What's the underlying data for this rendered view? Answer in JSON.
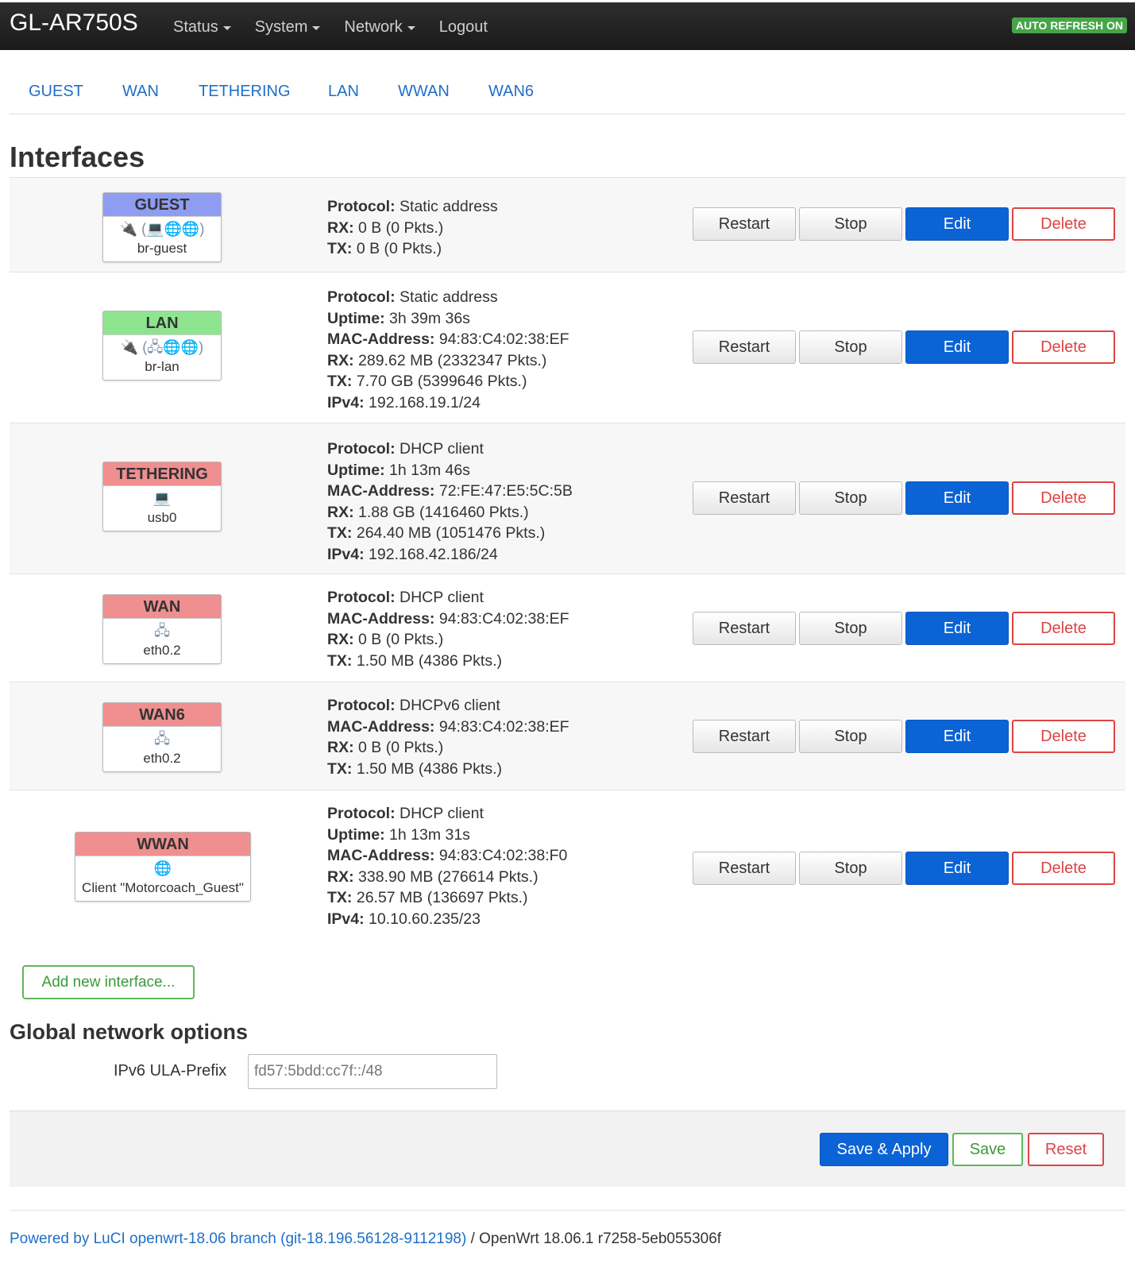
{
  "navbar": {
    "brand": "GL-AR750S",
    "menu": [
      {
        "label": "Status",
        "dropdown": true
      },
      {
        "label": "System",
        "dropdown": true
      },
      {
        "label": "Network",
        "dropdown": true
      },
      {
        "label": "Logout",
        "dropdown": false
      }
    ],
    "auto_refresh": "AUTO REFRESH ON"
  },
  "tabs": [
    "GUEST",
    "WAN",
    "TETHERING",
    "LAN",
    "WWAN",
    "WAN6"
  ],
  "page_title": "Interfaces",
  "buttons": {
    "restart": "Restart",
    "stop": "Stop",
    "edit": "Edit",
    "delete": "Delete"
  },
  "interfaces": [
    {
      "name": "GUEST",
      "header_color": "#8e9cf2",
      "icons": "🔌 (💻🌐🌐)",
      "device": "br-guest",
      "info": [
        {
          "label": "Protocol:",
          "value": "Static address"
        },
        {
          "label": "RX:",
          "value": "0 B (0 Pkts.)"
        },
        {
          "label": "TX:",
          "value": "0 B (0 Pkts.)"
        }
      ]
    },
    {
      "name": "LAN",
      "header_color": "#8fe58f",
      "icons": "🔌 (🖧🌐🌐)",
      "device": "br-lan",
      "info": [
        {
          "label": "Protocol:",
          "value": "Static address"
        },
        {
          "label": "Uptime:",
          "value": "3h 39m 36s"
        },
        {
          "label": "MAC-Address:",
          "value": "94:83:C4:02:38:EF"
        },
        {
          "label": "RX:",
          "value": "289.62 MB (2332347 Pkts.)"
        },
        {
          "label": "TX:",
          "value": "7.70 GB (5399646 Pkts.)"
        },
        {
          "label": "IPv4:",
          "value": "192.168.19.1/24"
        }
      ]
    },
    {
      "name": "TETHERING",
      "header_color": "#ef8f8f",
      "icons": "💻",
      "device": "usb0",
      "info": [
        {
          "label": "Protocol:",
          "value": "DHCP client"
        },
        {
          "label": "Uptime:",
          "value": "1h 13m 46s"
        },
        {
          "label": "MAC-Address:",
          "value": "72:FE:47:E5:5C:5B"
        },
        {
          "label": "RX:",
          "value": "1.88 GB (1416460 Pkts.)"
        },
        {
          "label": "TX:",
          "value": "264.40 MB (1051476 Pkts.)"
        },
        {
          "label": "IPv4:",
          "value": "192.168.42.186/24"
        }
      ]
    },
    {
      "name": "WAN",
      "header_color": "#ef8f8f",
      "icons": "🖧",
      "device": "eth0.2",
      "info": [
        {
          "label": "Protocol:",
          "value": "DHCP client"
        },
        {
          "label": "MAC-Address:",
          "value": "94:83:C4:02:38:EF"
        },
        {
          "label": "RX:",
          "value": "0 B (0 Pkts.)"
        },
        {
          "label": "TX:",
          "value": "1.50 MB (4386 Pkts.)"
        }
      ]
    },
    {
      "name": "WAN6",
      "header_color": "#ef8f8f",
      "icons": "🖧",
      "device": "eth0.2",
      "info": [
        {
          "label": "Protocol:",
          "value": "DHCPv6 client"
        },
        {
          "label": "MAC-Address:",
          "value": "94:83:C4:02:38:EF"
        },
        {
          "label": "RX:",
          "value": "0 B (0 Pkts.)"
        },
        {
          "label": "TX:",
          "value": "1.50 MB (4386 Pkts.)"
        }
      ]
    },
    {
      "name": "WWAN",
      "header_color": "#ef8f8f",
      "icons": "🌐",
      "device": "Client \"Motorcoach_Guest\"",
      "info": [
        {
          "label": "Protocol:",
          "value": "DHCP client"
        },
        {
          "label": "Uptime:",
          "value": "1h 13m 31s"
        },
        {
          "label": "MAC-Address:",
          "value": "94:83:C4:02:38:F0"
        },
        {
          "label": "RX:",
          "value": "338.90 MB (276614 Pkts.)"
        },
        {
          "label": "TX:",
          "value": "26.57 MB (136697 Pkts.)"
        },
        {
          "label": "IPv4:",
          "value": "10.10.60.235/23"
        }
      ]
    }
  ],
  "add_interface": "Add new interface...",
  "global": {
    "title": "Global network options",
    "ula_label": "IPv6 ULA-Prefix",
    "ula_value": "fd57:5bdd:cc7f::/48"
  },
  "actions": {
    "save_apply": "Save & Apply",
    "save": "Save",
    "reset": "Reset"
  },
  "footer": {
    "link": "Powered by LuCI openwrt-18.06 branch (git-18.196.56128-9112198)",
    "rest": " / OpenWrt 18.06.1 r7258-5eb055306f"
  },
  "colors": {
    "accent": "#0b63d6",
    "link": "#1e6fc8",
    "danger": "#dd4444",
    "success": "#5cb85c"
  }
}
